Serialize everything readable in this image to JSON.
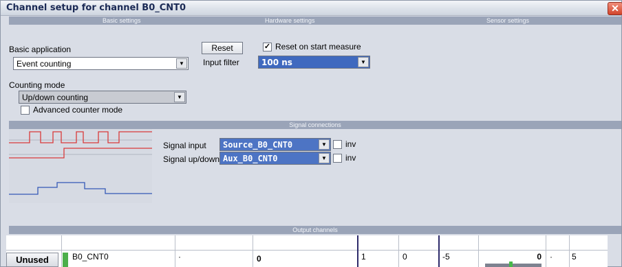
{
  "window": {
    "title": "Channel setup for channel B0_CNT0",
    "close_icon": "close-icon"
  },
  "sections": {
    "basic": "Basic settings",
    "hardware": "Hardware settings",
    "sensor": "Sensor settings",
    "signal": "Signal connections",
    "output": "Output channels"
  },
  "basic": {
    "app_label": "Basic application",
    "app_value": "Event counting",
    "mode_label": "Counting mode",
    "mode_value": "Up/down counting",
    "advanced_label": "Advanced counter mode",
    "advanced_checked": false
  },
  "hardware": {
    "reset_label": "Reset",
    "reset_on_start_label": "Reset on start measure",
    "reset_on_start_checked": true,
    "input_filter_label": "Input filter",
    "input_filter_value": "100 ns"
  },
  "signals": {
    "input_label": "Signal input",
    "input_value": "Source_B0_CNT0",
    "input_inv_label": "inv",
    "updown_label": "Signal up/down",
    "updown_value": "Aux_B0_CNT0",
    "updown_inv_label": "inv"
  },
  "output_row": {
    "status": "Unused",
    "name": "B0_CNT0",
    "c3": "·",
    "c4": "0",
    "c5": "1",
    "c6": "0",
    "c7": "-5",
    "c8": "0",
    "c9": "·",
    "c10": "5"
  },
  "colors": {
    "header_bar": "#9aa4b8",
    "selected_blue": "#3f69bf",
    "trace_red": "#d9393a",
    "trace_blue": "#3458b6"
  }
}
